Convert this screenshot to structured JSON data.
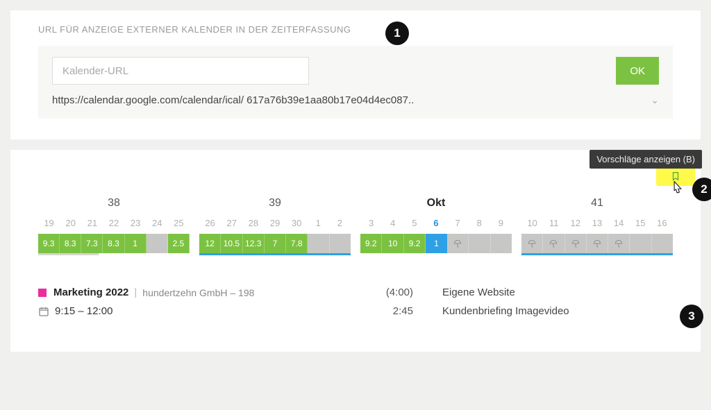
{
  "section_title": "URL FÜR ANZEIGE EXTERNER KALENDER IN DER ZEITERFASSUNG",
  "url_input_placeholder": "Kalender-URL",
  "ok_label": "OK",
  "listed_url": "https://calendar.google.com/calendar/ical/ 617a76b39e1aa80b17e04d4ec087..",
  "tooltip": "Vorschläge anzeigen (B)",
  "weeks": [
    {
      "label": "38",
      "days": [
        "19",
        "20",
        "21",
        "22",
        "23",
        "24",
        "25"
      ],
      "cells": [
        {
          "v": "9.3",
          "c": "g"
        },
        {
          "v": "8.3",
          "c": "g"
        },
        {
          "v": "7.3",
          "c": "g"
        },
        {
          "v": "8.3",
          "c": "g"
        },
        {
          "v": "1",
          "c": "g"
        },
        {
          "v": "",
          "c": "gr"
        },
        {
          "v": "2.5",
          "c": "g"
        }
      ],
      "underline": "gray"
    },
    {
      "label": "39",
      "days": [
        "26",
        "27",
        "28",
        "29",
        "30",
        "1",
        "2"
      ],
      "cells": [
        {
          "v": "12",
          "c": "g"
        },
        {
          "v": "10.5",
          "c": "g"
        },
        {
          "v": "12.3",
          "c": "g"
        },
        {
          "v": "7",
          "c": "g"
        },
        {
          "v": "7.8",
          "c": "g"
        },
        {
          "v": "",
          "c": "gr"
        },
        {
          "v": "",
          "c": "gr-last"
        }
      ],
      "underline": "blue"
    },
    {
      "label": "Okt",
      "bold": true,
      "days": [
        "3",
        "4",
        "5",
        "6",
        "7",
        "8",
        "9"
      ],
      "today_idx": 3,
      "cells": [
        {
          "v": "9.2",
          "c": "g"
        },
        {
          "v": "10",
          "c": "g"
        },
        {
          "v": "9.2",
          "c": "g"
        },
        {
          "v": "1",
          "c": "bl"
        },
        {
          "v": "",
          "c": "gr",
          "vac": true
        },
        {
          "v": "",
          "c": "gr"
        },
        {
          "v": "",
          "c": "gr-last"
        }
      ],
      "underline": "none"
    },
    {
      "label": "41",
      "days": [
        "10",
        "11",
        "12",
        "13",
        "14",
        "15",
        "16"
      ],
      "cells": [
        {
          "v": "",
          "c": "gr",
          "vac": true
        },
        {
          "v": "",
          "c": "gr",
          "vac": true
        },
        {
          "v": "",
          "c": "gr",
          "vac": true
        },
        {
          "v": "",
          "c": "gr",
          "vac": true
        },
        {
          "v": "",
          "c": "gr",
          "vac": true
        },
        {
          "v": "",
          "c": "gr"
        },
        {
          "v": "",
          "c": "gr-last"
        }
      ],
      "underline": "blue"
    }
  ],
  "entry": {
    "project": "Marketing 2022",
    "client": "hundertzehn GmbH – 198",
    "total": "(4:00)",
    "desc1": "Eigene Website",
    "time_range": "9:15 – 12:00",
    "dur": "2:45",
    "desc2": "Kundenbriefing Imagevideo"
  },
  "badges": {
    "b1": "1",
    "b2": "2",
    "b3": "3"
  }
}
